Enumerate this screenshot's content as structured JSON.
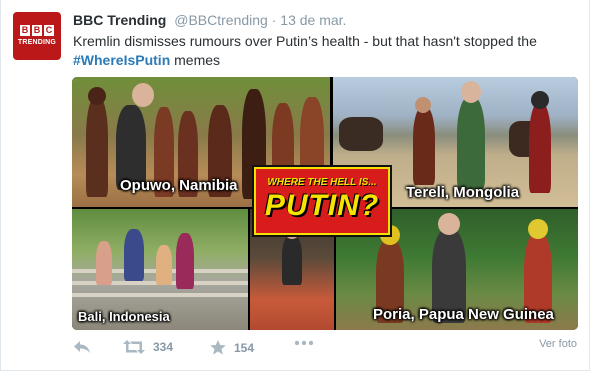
{
  "author": {
    "name": "BBC Trending",
    "handle": "@BBCtrending",
    "separator": "·",
    "time": "13 de mar.",
    "avatar_blocks": [
      "B",
      "B",
      "C"
    ],
    "avatar_label": "TRENDING"
  },
  "tweet": {
    "text_before": "Kremlin dismisses rumours over Putin’s health - but that hasn't stopped the ",
    "hashtag": "#WhereIsPutin",
    "text_after": " memes"
  },
  "media": {
    "panels": [
      {
        "caption": "Opuwo, Namibia"
      },
      {
        "caption": "Tereli, Mongolia"
      },
      {
        "caption": "Bali, Indonesia"
      },
      {
        "caption": ""
      },
      {
        "caption": "Poria, Papua New Guinea"
      }
    ],
    "badge_top": "WHERE THE HELL IS...",
    "badge_main": "PUTIN?"
  },
  "actions": {
    "retweets": "334",
    "favorites": "154",
    "view_photo": "Ver foto"
  },
  "colors": {
    "brand": "#bb1919",
    "link": "#2b7bb9",
    "muted": "#8899a6"
  }
}
